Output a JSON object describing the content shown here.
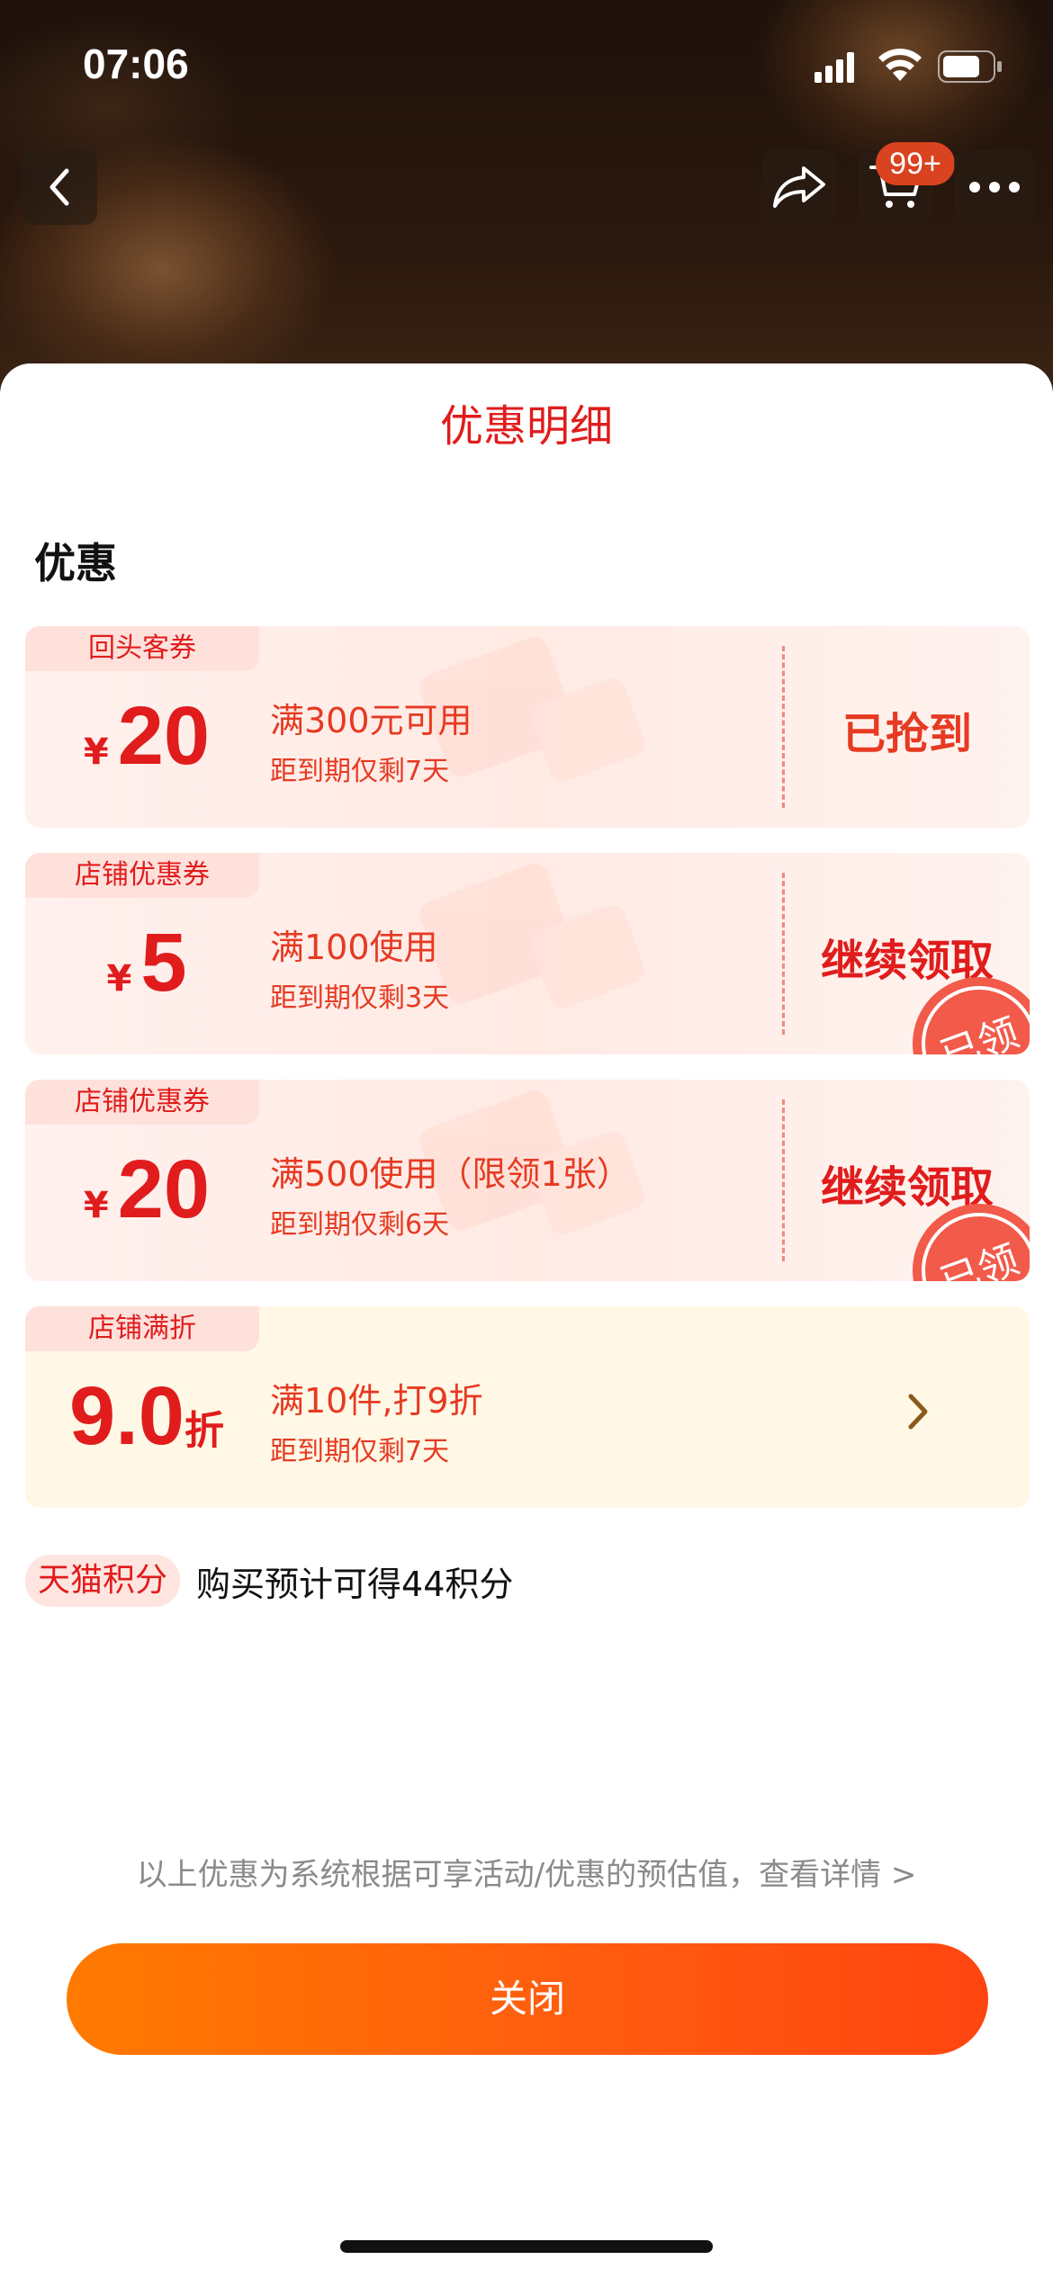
{
  "status_bar": {
    "time": "07:06"
  },
  "nav": {
    "cart_badge": "99+"
  },
  "sheet": {
    "title": "优惠明细",
    "section_title": "优惠",
    "coupons": [
      {
        "tag": "回头客券",
        "currency": "¥",
        "amount": "20",
        "unit": "",
        "condition": "满300元可用",
        "expiry": "距到期仅剩7天",
        "action": "已抢到",
        "claimed_stamp": ""
      },
      {
        "tag": "店铺优惠券",
        "currency": "¥",
        "amount": "5",
        "unit": "",
        "condition": "满100使用",
        "expiry": "距到期仅剩3天",
        "action": "继续领取",
        "claimed_stamp": "已领"
      },
      {
        "tag": "店铺优惠券",
        "currency": "¥",
        "amount": "20",
        "unit": "",
        "condition": "满500使用（限领1张）",
        "expiry": "距到期仅剩6天",
        "action": "继续领取",
        "claimed_stamp": "已领"
      },
      {
        "tag": "店铺满折",
        "currency": "",
        "amount": "9.0",
        "unit": "折",
        "condition": "满10件,打9折",
        "expiry": "距到期仅剩7天",
        "action": "",
        "claimed_stamp": ""
      }
    ],
    "points": {
      "tag": "天猫积分",
      "text": "购买预计可得44积分"
    },
    "footnote": "以上优惠为系统根据可享活动/优惠的预估值，查看详情 >",
    "close_label": "关闭"
  },
  "colors": {
    "accent_red": "#e01c1c",
    "button_orange": "#ff6a00"
  }
}
